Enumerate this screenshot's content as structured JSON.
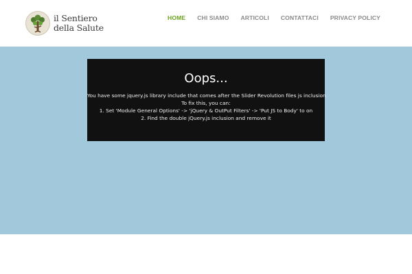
{
  "brand": {
    "line1": "il Sentiero",
    "line2": "della Salute",
    "logo_icon": "tree-icon"
  },
  "nav": {
    "items": [
      {
        "label": "HOME",
        "active": true
      },
      {
        "label": "CHI SIAMO",
        "active": false
      },
      {
        "label": "ARTICOLI",
        "active": false
      },
      {
        "label": "CONTATTACI",
        "active": false
      },
      {
        "label": "PRIVACY POLICY",
        "active": false
      }
    ],
    "active_color": "#6aa121",
    "color": "#8a8a8a"
  },
  "hero": {
    "background": "#a1c8db"
  },
  "error_box": {
    "title": "Oops...",
    "lines": [
      "You have some jquery.js library include that comes after the Slider Revolution files js inclusion.",
      "To fix this, you can:",
      "1. Set 'Module General Options' -> 'jQuery & OutPut Filters' -> 'Put JS to Body' to on",
      "2. Find the double jQuery.js inclusion and remove it"
    ],
    "background": "#111111"
  }
}
